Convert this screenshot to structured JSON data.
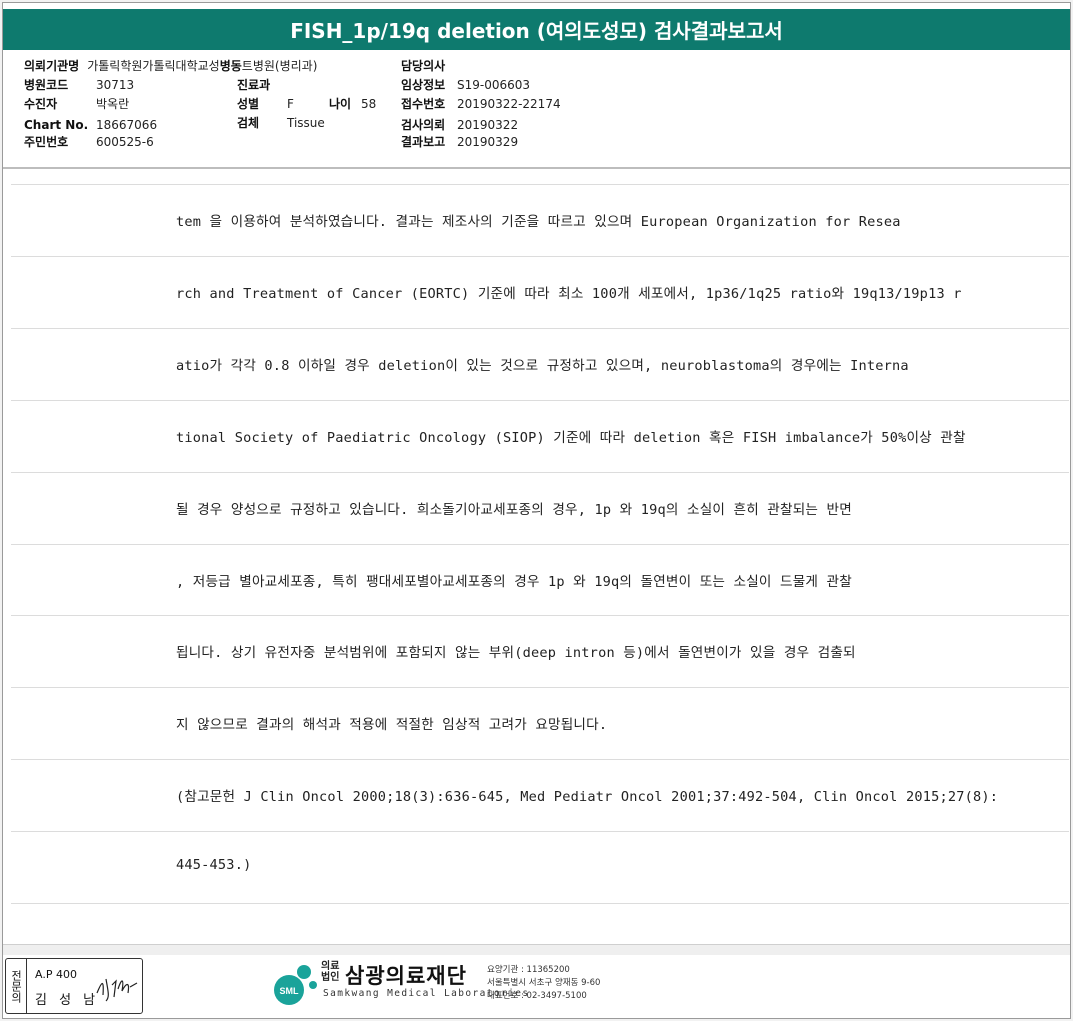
{
  "title": "FISH_1p/19q deletion (여의도성모) 검사결과보고서",
  "header": {
    "institution_label": "의뢰기관명",
    "institution_value": "가톨릭학원가톨릭대학교성",
    "ward_label": "병동",
    "ward_value": "트병원(병리과)",
    "hospital_code_label": "병원코드",
    "hospital_code_value": "30713",
    "patient_label": "수진자",
    "patient_value": "박옥란",
    "chart_label": "Chart No.",
    "chart_value": "18667066",
    "rrn_label": "주민번호",
    "rrn_value": "600525-6",
    "department_label": "진료과",
    "department_value": "",
    "sex_label": "성별",
    "sex_value": "F",
    "age_label": "나이",
    "age_value": "58",
    "specimen_label": "검체",
    "specimen_value": "Tissue",
    "doctor_label": "담당의사",
    "doctor_value": "",
    "clinical_label": "임상정보",
    "clinical_value": "S19-006603",
    "receipt_label": "접수번호",
    "receipt_value": "20190322-22174",
    "request_label": "검사의뢰",
    "request_value": "20190322",
    "report_label": "결과보고",
    "report_value": "20190329"
  },
  "body_lines": [
    "tem 을 이용하여 분석하였습니다. 결과는 제조사의 기준을 따르고 있으며 European Organization for Resea",
    "rch and Treatment of Cancer (EORTC) 기준에 따라 최소 100개 세포에서, 1p36/1q25 ratio와 19q13/19p13 r",
    "atio가 각각 0.8 이하일 경우 deletion이 있는 것으로 규정하고 있으며, neuroblastoma의 경우에는 Interna",
    "tional Society of Paediatric Oncology (SIOP) 기준에 따라 deletion 혹은 FISH imbalance가 50%이상 관찰",
    "될 경우 양성으로 규정하고 있습니다. 희소돌기아교세포종의 경우, 1p 와 19q의 소실이 흔히 관찰되는 반면",
    ", 저등급 별아교세포종, 특히 팽대세포별아교세포종의 경우 1p 와 19q의 돌연변이 또는 소실이 드물게 관찰",
    "됩니다. 상기 유전자중 분석범위에 포함되지 않는 부위(deep intron 등)에서 돌연변이가 있을 경우 검출되",
    "지 않으므로 결과의 해석과 적용에 적절한 임상적 고려가 요망됩니다.",
    "(참고문헌 J Clin Oncol 2000;18(3):636-645, Med Pediatr Oncol 2001;37:492-504, Clin Oncol 2015;27(8):",
    "445-453.)"
  ],
  "footer": {
    "stamp_side": "전문의",
    "stamp_code": "A.P 400",
    "stamp_name": "김 성 남",
    "logo_badge": "SML",
    "logo_prefix_1": "의료",
    "logo_prefix_2": "법인",
    "logo_name": "삼광의료재단",
    "logo_eng": "Samkwang Medical Laboratories",
    "info_1": "요양기관 : 11365200",
    "info_2": "서울특별시 서초구 양재동 9-60",
    "info_3": "대표번호 : 02-3497-5100"
  },
  "colors": {
    "title_bar": "#0e7a6e",
    "logo_teal": "#1aa39a"
  }
}
